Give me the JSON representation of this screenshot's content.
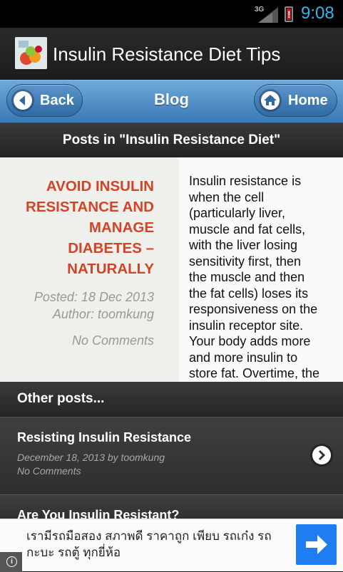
{
  "status_bar": {
    "network": "3G",
    "time": "9:08",
    "battery_alert": "!"
  },
  "app": {
    "title": "Insulin Resistance Diet Tips",
    "logo_icon": "fruit-logo-icon"
  },
  "nav": {
    "back_label": "Back",
    "title": "Blog",
    "home_label": "Home",
    "accent": "#3b79b4"
  },
  "posts_heading": "Posts in \"Insulin Resistance Diet\"",
  "post": {
    "title_lines": [
      "AVOID INSULIN",
      "RESISTANCE AND",
      "MANAGE",
      "DIABETES –",
      "NATURALLY"
    ],
    "posted": "Posted: 18 Dec 2013",
    "author": "Author: toomkung",
    "comments": "No Comments",
    "excerpt_lines": [
      "Insulin resistance is",
      "when the cell",
      "(particularly liver,",
      "muscle and fat cells,",
      "with the liver losing",
      "sensitivity first, then",
      "the muscle and then",
      "the fat cells) loses its",
      "responsiveness on the",
      "insulin receptor site.",
      "Your body adds more",
      "and more insulin to",
      "store fat. Overtime, the"
    ],
    "title_color": "#d04527"
  },
  "other_posts": {
    "heading": "Other posts...",
    "items": [
      {
        "title": "Resisting Insulin Resistance",
        "date": "December 18, 2013 by toomkung",
        "comments": "No Comments"
      },
      {
        "title": "Are You Insulin Resistant?"
      }
    ]
  },
  "ad": {
    "line1": "เรามีรถมือสอง สภาพดี ราคาถูก เพียบ รถเก๋ง รถ",
    "line2": "กะบะ รถตู้ ทุกยี่ห้อ",
    "info": "i",
    "button_color": "#1e7df0"
  }
}
